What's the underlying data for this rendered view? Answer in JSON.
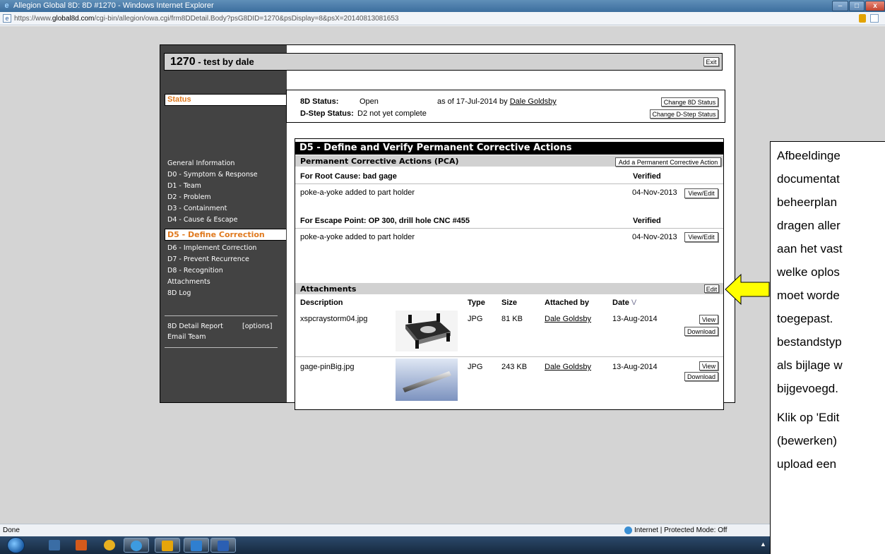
{
  "window": {
    "title": "Allegion Global 8D: 8D #1270 - Windows Internet Explorer",
    "url_prefix": "https://www.",
    "url_domain": "global8d.com",
    "url_rest": "/cgi-bin/allegion/owa.cgi/frm8DDetail.Body?psG8DID=1270&psDisplay=8&psX=20140813081653",
    "min": "–",
    "max": "□",
    "close": "x"
  },
  "header": {
    "title_num": "1270",
    "title_sep": " - ",
    "title_name": "test by dale",
    "exit": "Exit"
  },
  "status": {
    "tab_label": "Status",
    "status_label": "8D Status:",
    "status_value": "Open",
    "as_of": "as of 17-Jul-2014 by",
    "by_user": "Dale Goldsby",
    "dstep_label": "D-Step Status:",
    "dstep_value": "D2 not yet complete",
    "change_8d": "Change 8D Status",
    "change_dstep": "Change D-Step Status"
  },
  "nav": {
    "items": [
      "General Information",
      "D0 - Symptom & Response",
      "D1 - Team",
      "D2 - Problem",
      "D3 - Containment",
      "D4 - Cause & Escape"
    ],
    "active": "D5 - Define Correction",
    "items_after": [
      "D6 - Implement Correction",
      "D7 - Prevent Recurrence",
      "D8 - Recognition",
      "Attachments",
      "8D Log"
    ],
    "report": "8D Detail Report",
    "options": "[options]",
    "email": "Email Team"
  },
  "d5": {
    "title": "D5 - Define and Verify Permanent Corrective Actions",
    "pca_title": "Permanent Corrective Actions (PCA)",
    "add_pca": "Add a Permanent Corrective Action",
    "groups": [
      {
        "heading": "For Root Cause: bad  gage",
        "verified_label": "Verified",
        "action": "poke-a-yoke added to part holder",
        "date": "04-Nov-2013",
        "button": "View/Edit"
      },
      {
        "heading": "For Escape Point: OP 300, drill hole CNC #455",
        "verified_label": "Verified",
        "action": "poke-a-yoke added to part holder",
        "date": "04-Nov-2013",
        "button": "View/Edit"
      }
    ]
  },
  "attachments": {
    "title": "Attachments",
    "edit": "Edit",
    "columns": {
      "description": "Description",
      "type": "Type",
      "size": "Size",
      "attached_by": "Attached by",
      "date": "Date",
      "sort_glyph": "V"
    },
    "rows": [
      {
        "description": "xspcraystorm04.jpg",
        "type": "JPG",
        "size": "81 KB",
        "attached_by": "Dale Goldsby",
        "date": "13-Aug-2014",
        "view": "View",
        "download": "Download"
      },
      {
        "description": "gage-pinBig.jpg",
        "type": "JPG",
        "size": "243 KB",
        "attached_by": "Dale Goldsby",
        "date": "13-Aug-2014",
        "view": "View",
        "download": "Download"
      }
    ]
  },
  "callout": {
    "lines_p1": [
      "Afbeeldinge",
      "documentat",
      "beheerplan",
      "dragen aller",
      "aan het vast",
      "welke oplos",
      "moet worde",
      "toegepast.",
      "bestandstyp",
      "als bijlage w",
      "bijgevoegd."
    ],
    "lines_p2": [
      "Klik op 'Edit",
      "(bewerken)",
      "upload een"
    ]
  },
  "statusbar": {
    "done": "Done",
    "zone": "Internet | Protected Mode: Off"
  },
  "colors": {
    "accent_orange": "#e07a1f",
    "sidebar": "#434343",
    "arrow_yellow": "#ffff00"
  }
}
